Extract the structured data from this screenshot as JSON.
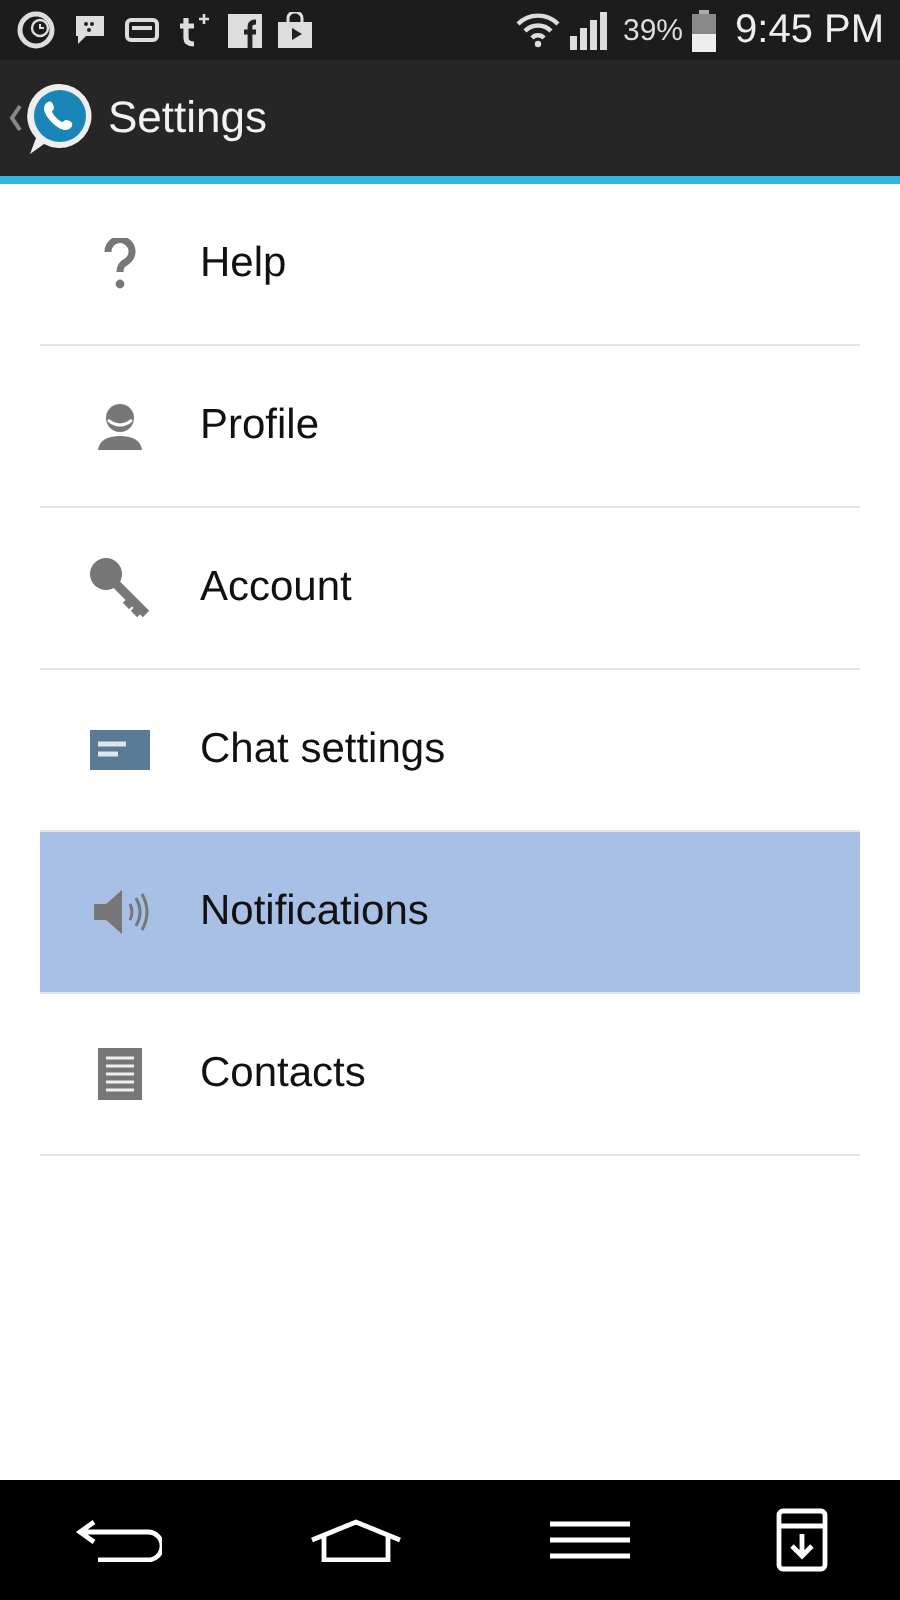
{
  "status_bar": {
    "battery": "39%",
    "time": "9:45 PM"
  },
  "action_bar": {
    "title": "Settings"
  },
  "menu": [
    {
      "label": "Help",
      "kind": "help",
      "selected": false
    },
    {
      "label": "Profile",
      "kind": "profile",
      "selected": false
    },
    {
      "label": "Account",
      "kind": "account",
      "selected": false
    },
    {
      "label": "Chat settings",
      "kind": "chat",
      "selected": false
    },
    {
      "label": "Notifications",
      "kind": "notifications",
      "selected": true
    },
    {
      "label": "Contacts",
      "kind": "contacts",
      "selected": false
    }
  ]
}
